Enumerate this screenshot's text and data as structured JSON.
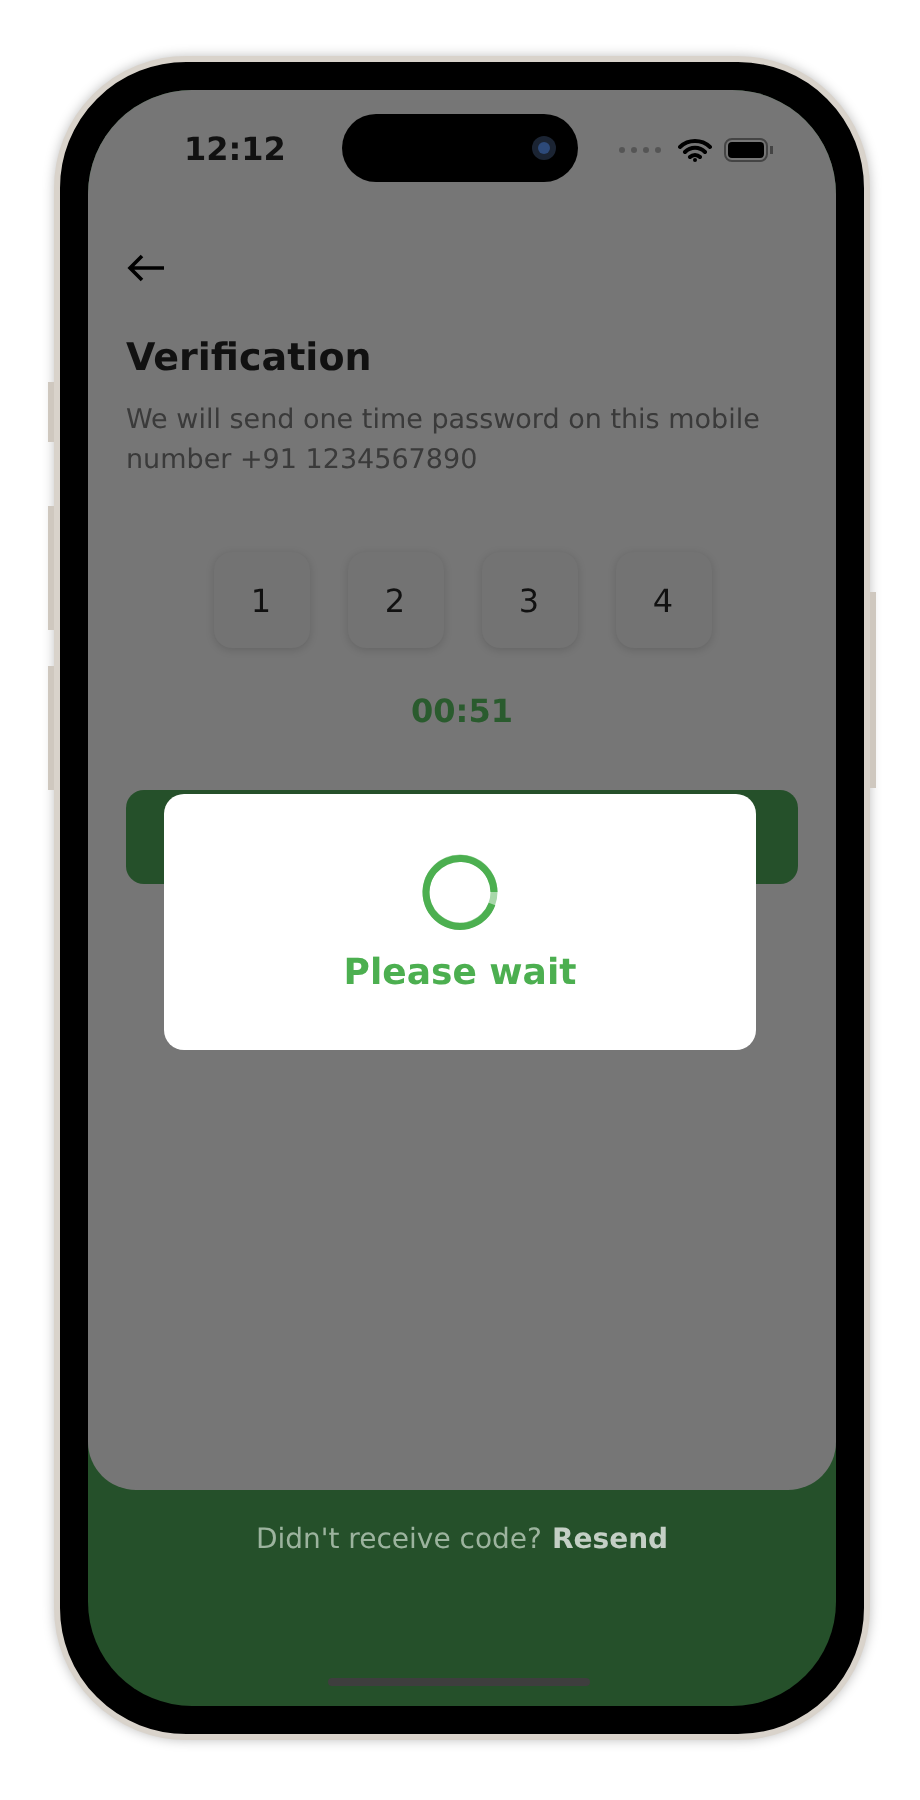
{
  "status_bar": {
    "time": "12:12"
  },
  "verification": {
    "title": "Verification",
    "subtitle": "We will send one time password on this mobile number +91 1234567890",
    "otp_digits": [
      "1",
      "2",
      "3",
      "4"
    ],
    "timer": "00:51"
  },
  "footer": {
    "prompt": "Didn't receive code?",
    "link": "Resend"
  },
  "loading_dialog": {
    "message": "Please wait"
  }
}
